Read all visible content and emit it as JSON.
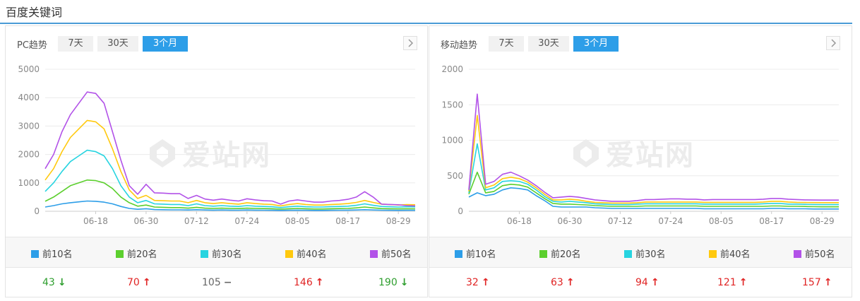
{
  "page": {
    "title": "百度关键词"
  },
  "panels": [
    {
      "id": "pc",
      "title": "PC趋势",
      "tabs": [
        {
          "label": "7天",
          "active": false
        },
        {
          "label": "30天",
          "active": false
        },
        {
          "label": "3个月",
          "active": true
        }
      ],
      "watermark": "爱站网",
      "legend": [
        "前10名",
        "前20名",
        "前30名",
        "前40名",
        "前50名"
      ],
      "stats": [
        {
          "value": "43",
          "trend": "down"
        },
        {
          "value": "70",
          "trend": "up"
        },
        {
          "value": "105",
          "trend": "flat"
        },
        {
          "value": "146",
          "trend": "up"
        },
        {
          "value": "190",
          "trend": "down"
        }
      ]
    },
    {
      "id": "mobile",
      "title": "移动趋势",
      "tabs": [
        {
          "label": "7天",
          "active": false
        },
        {
          "label": "30天",
          "active": false
        },
        {
          "label": "3个月",
          "active": true
        }
      ],
      "watermark": "爱站网",
      "legend": [
        "前10名",
        "前20名",
        "前30名",
        "前40名",
        "前50名"
      ],
      "stats": [
        {
          "value": "32",
          "trend": "up"
        },
        {
          "value": "63",
          "trend": "up"
        },
        {
          "value": "94",
          "trend": "up"
        },
        {
          "value": "121",
          "trend": "up"
        },
        {
          "value": "157",
          "trend": "up"
        }
      ]
    }
  ],
  "colors": {
    "accent": "#2d9ee8",
    "series": [
      "#2d9ee8",
      "#5ccf2e",
      "#27d4e0",
      "#ffc90e",
      "#b252e8"
    ],
    "up": "#e02424",
    "down": "#2e9e2e"
  },
  "chart_data": [
    {
      "type": "line",
      "ylim": [
        0,
        5000
      ],
      "yticks": [
        0,
        1000,
        2000,
        3000,
        4000,
        5000
      ],
      "xticks": [
        "06-18",
        "06-30",
        "07-12",
        "07-24",
        "08-05",
        "08-17",
        "08-29"
      ],
      "x": [
        "06-06",
        "06-08",
        "06-10",
        "06-12",
        "06-14",
        "06-16",
        "06-18",
        "06-20",
        "06-22",
        "06-24",
        "06-26",
        "06-28",
        "06-30",
        "07-02",
        "07-04",
        "07-06",
        "07-08",
        "07-10",
        "07-12",
        "07-14",
        "07-16",
        "07-18",
        "07-20",
        "07-22",
        "07-24",
        "07-26",
        "07-28",
        "07-30",
        "08-01",
        "08-03",
        "08-05",
        "08-07",
        "08-09",
        "08-11",
        "08-13",
        "08-15",
        "08-17",
        "08-19",
        "08-21",
        "08-23",
        "08-25",
        "08-27",
        "08-29",
        "08-31",
        "09-02"
      ],
      "series": [
        {
          "name": "前10名",
          "values": [
            150,
            200,
            260,
            300,
            330,
            360,
            350,
            320,
            260,
            170,
            100,
            70,
            90,
            60,
            55,
            50,
            50,
            45,
            55,
            45,
            40,
            45,
            40,
            38,
            45,
            40,
            38,
            35,
            30,
            35,
            40,
            35,
            30,
            30,
            35,
            38,
            40,
            45,
            55,
            45,
            38,
            35,
            33,
            35,
            34
          ]
        },
        {
          "name": "前20名",
          "values": [
            350,
            500,
            700,
            900,
            1000,
            1100,
            1080,
            1000,
            800,
            500,
            300,
            180,
            220,
            150,
            140,
            130,
            130,
            110,
            140,
            110,
            100,
            110,
            100,
            95,
            110,
            100,
            95,
            90,
            75,
            90,
            100,
            90,
            80,
            80,
            90,
            95,
            100,
            120,
            150,
            120,
            95,
            90,
            85,
            90,
            88
          ]
        },
        {
          "name": "前30名",
          "values": [
            700,
            1000,
            1400,
            1750,
            1950,
            2150,
            2100,
            1950,
            1500,
            900,
            500,
            300,
            380,
            260,
            250,
            240,
            240,
            200,
            260,
            200,
            180,
            200,
            180,
            170,
            200,
            180,
            170,
            160,
            130,
            160,
            180,
            160,
            150,
            150,
            165,
            170,
            180,
            210,
            260,
            210,
            170,
            160,
            150,
            160,
            155
          ]
        },
        {
          "name": "前40名",
          "values": [
            1100,
            1500,
            2100,
            2600,
            2900,
            3200,
            3150,
            2900,
            2200,
            1400,
            750,
            450,
            560,
            380,
            370,
            360,
            360,
            300,
            380,
            300,
            270,
            300,
            270,
            250,
            300,
            270,
            250,
            240,
            190,
            240,
            270,
            240,
            220,
            220,
            240,
            250,
            270,
            310,
            380,
            310,
            250,
            240,
            220,
            235,
            228
          ]
        },
        {
          "name": "前50名",
          "values": [
            1500,
            2000,
            2800,
            3400,
            3800,
            4200,
            4150,
            3800,
            2800,
            1800,
            900,
            600,
            950,
            650,
            640,
            620,
            620,
            450,
            560,
            430,
            390,
            430,
            390,
            360,
            440,
            400,
            370,
            360,
            250,
            360,
            400,
            360,
            320,
            320,
            360,
            380,
            420,
            500,
            690,
            500,
            250,
            240,
            230,
            200,
            190
          ]
        }
      ]
    },
    {
      "type": "line",
      "ylim": [
        0,
        2000
      ],
      "yticks": [
        0,
        500,
        1000,
        1500,
        2000
      ],
      "xticks": [
        "06-18",
        "06-30",
        "07-12",
        "07-24",
        "08-05",
        "08-17",
        "08-29"
      ],
      "x": [
        "06-06",
        "06-08",
        "06-10",
        "06-12",
        "06-14",
        "06-16",
        "06-18",
        "06-20",
        "06-22",
        "06-24",
        "06-26",
        "06-28",
        "06-30",
        "07-02",
        "07-04",
        "07-06",
        "07-08",
        "07-10",
        "07-12",
        "07-14",
        "07-16",
        "07-18",
        "07-20",
        "07-22",
        "07-24",
        "07-26",
        "07-28",
        "07-30",
        "08-01",
        "08-03",
        "08-05",
        "08-07",
        "08-09",
        "08-11",
        "08-13",
        "08-15",
        "08-17",
        "08-19",
        "08-21",
        "08-23",
        "08-25",
        "08-27",
        "08-29",
        "08-31",
        "09-02"
      ],
      "series": [
        {
          "name": "前10名",
          "values": [
            200,
            260,
            220,
            240,
            300,
            330,
            320,
            300,
            220,
            150,
            70,
            60,
            60,
            60,
            60,
            50,
            45,
            40,
            40,
            40,
            40,
            40,
            40,
            40,
            40,
            40,
            40,
            40,
            35,
            35,
            35,
            35,
            35,
            35,
            35,
            35,
            40,
            40,
            35,
            35,
            35,
            32,
            32,
            32,
            32
          ]
        },
        {
          "name": "前20名",
          "values": [
            240,
            550,
            260,
            280,
            360,
            380,
            370,
            340,
            260,
            180,
            110,
            100,
            100,
            95,
            90,
            80,
            75,
            70,
            70,
            70,
            70,
            75,
            75,
            75,
            75,
            75,
            75,
            75,
            70,
            70,
            70,
            70,
            70,
            70,
            70,
            70,
            75,
            75,
            70,
            70,
            68,
            65,
            63,
            63,
            63
          ]
        },
        {
          "name": "前30名",
          "values": [
            260,
            950,
            300,
            330,
            420,
            430,
            420,
            380,
            300,
            210,
            140,
            130,
            140,
            130,
            120,
            105,
            100,
            95,
            95,
            95,
            100,
            105,
            105,
            105,
            105,
            105,
            105,
            105,
            100,
            100,
            100,
            100,
            100,
            100,
            100,
            105,
            110,
            110,
            100,
            100,
            98,
            96,
            94,
            94,
            94
          ]
        },
        {
          "name": "前40名",
          "values": [
            280,
            1350,
            330,
            370,
            460,
            480,
            460,
            410,
            330,
            240,
            160,
            160,
            170,
            160,
            140,
            125,
            120,
            115,
            115,
            115,
            120,
            130,
            130,
            130,
            130,
            130,
            130,
            130,
            125,
            125,
            125,
            125,
            125,
            125,
            125,
            130,
            140,
            140,
            130,
            125,
            123,
            122,
            121,
            121,
            121
          ]
        },
        {
          "name": "前50名",
          "values": [
            300,
            1650,
            380,
            420,
            520,
            550,
            500,
            440,
            360,
            270,
            190,
            200,
            210,
            200,
            180,
            160,
            150,
            140,
            140,
            140,
            150,
            165,
            165,
            170,
            175,
            175,
            170,
            170,
            160,
            165,
            165,
            165,
            165,
            165,
            165,
            170,
            180,
            180,
            170,
            165,
            160,
            158,
            157,
            157,
            157
          ]
        }
      ]
    }
  ]
}
